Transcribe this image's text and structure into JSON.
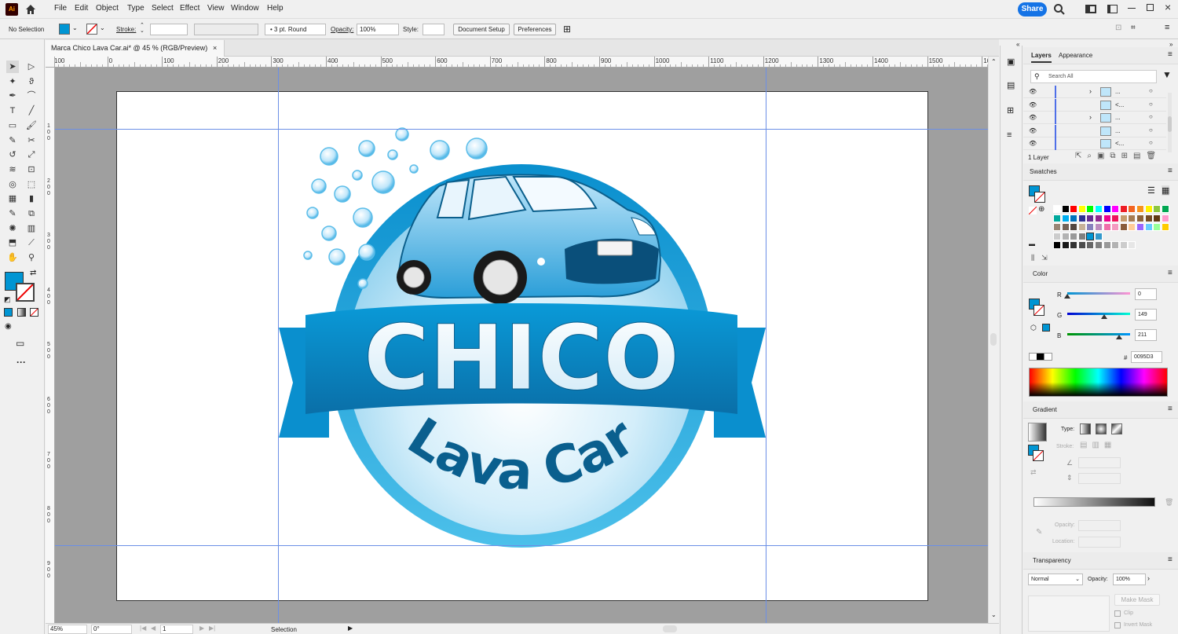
{
  "app": {
    "logo": "Ai"
  },
  "menu": [
    "File",
    "Edit",
    "Object",
    "Type",
    "Select",
    "Effect",
    "View",
    "Window",
    "Help"
  ],
  "header": {
    "share_label": "Share"
  },
  "control_bar": {
    "selection_state": "No Selection",
    "stroke_label": "Stroke:",
    "brush_label": "3 pt. Round",
    "opacity_label": "Opacity:",
    "opacity_value": "100%",
    "style_label": "Style:",
    "document_setup": "Document Setup",
    "preferences": "Preferences"
  },
  "document": {
    "tab_title": "Marca Chico Lava Car.ai* @ 45 % (RGB/Preview)",
    "close": "×"
  },
  "rulers": {
    "h_ticks": [
      "100",
      "0",
      "100",
      "200",
      "300",
      "400",
      "500",
      "600",
      "700",
      "800",
      "900",
      "1000",
      "1100",
      "1200",
      "1300",
      "1400",
      "1500",
      "16"
    ],
    "v_ticks": [
      "1",
      "0",
      "0",
      "2",
      "0",
      "0",
      "3",
      "0",
      "0",
      "4",
      "0",
      "0",
      "5",
      "0",
      "0",
      "6",
      "0",
      "0",
      "7",
      "0",
      "0",
      "8",
      "0",
      "0",
      "9",
      "0",
      "0"
    ]
  },
  "artwork": {
    "banner_text": "CHICO",
    "sub_text": "Lava Car",
    "colors": {
      "primary": "#0095D3",
      "dark": "#0a5f8e",
      "light": "#dff3fc"
    }
  },
  "status": {
    "zoom": "45%",
    "rotation": "0°",
    "artboard": "1",
    "tool": "Selection"
  },
  "layers_panel": {
    "tabs": [
      "Layers",
      "Appearance"
    ],
    "search_placeholder": "Search All",
    "rows": [
      {
        "name": "...",
        "expand": "›"
      },
      {
        "name": "<...",
        "expand": ""
      },
      {
        "name": "...",
        "expand": "›"
      },
      {
        "name": "...",
        "expand": ""
      },
      {
        "name": "<...",
        "expand": ""
      }
    ],
    "count": "1 Layer"
  },
  "swatches_panel": {
    "title": "Swatches",
    "rows": [
      [
        "#ffffff",
        "#000000",
        "#ff0000",
        "#ffff00",
        "#00ff00",
        "#00ffff",
        "#0000ff",
        "#ff00ff",
        "#ed1c24",
        "#f26522",
        "#f7941d",
        "#fff200",
        "#8dc63f",
        "#00a651"
      ],
      [
        "#00a99d",
        "#00aeef",
        "#0072bc",
        "#2e3192",
        "#662d91",
        "#92278f",
        "#ec008c",
        "#ed145b",
        "#c69c6d",
        "#a67c52",
        "#8c6239",
        "#754c24",
        "#603913",
        "#ff99cc"
      ],
      [
        "#998675",
        "#736357",
        "#534741",
        "#c7b299",
        "#8781bd",
        "#bd8cbf",
        "#f06eaa",
        "#f49ac1",
        "#8a5d3b",
        "#ffcc99",
        "#9966ff",
        "#66ccff",
        "#99ff99",
        "#ffcc00"
      ],
      [
        "#cccccc",
        "#b3b3b3",
        "#999999",
        "#808080",
        "#0095d3",
        "#3399cc"
      ],
      [
        "#000000",
        "#1a1a1a",
        "#333333",
        "#4d4d4d",
        "#666666",
        "#808080",
        "#999999",
        "#b3b3b3",
        "#cccccc",
        "#e6e6e6"
      ]
    ]
  },
  "color_panel": {
    "title": "Color",
    "r_label": "R",
    "g_label": "G",
    "b_label": "B",
    "r": "0",
    "g": "149",
    "b": "211",
    "hash": "#",
    "hex": "0095D3"
  },
  "gradient_panel": {
    "title": "Gradient",
    "type_label": "Type:",
    "stroke_label": "Stroke:",
    "opacity_label": "Opacity:",
    "location_label": "Location:"
  },
  "transparency_panel": {
    "title": "Transparency",
    "mode": "Normal",
    "opacity_label": "Opacity:",
    "opacity_value": "100%",
    "make_mask": "Make Mask",
    "clip": "Clip",
    "invert_mask": "Invert Mask"
  }
}
